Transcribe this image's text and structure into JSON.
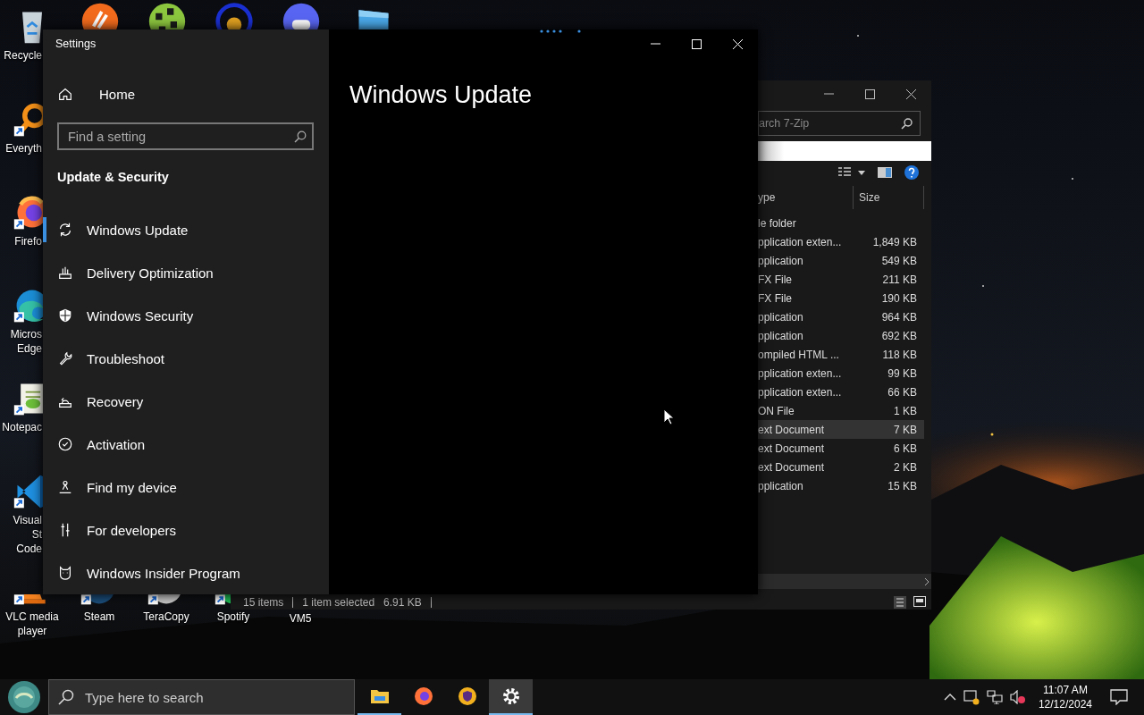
{
  "desktop": {
    "top_icons": [
      {
        "kind": "orange-app"
      },
      {
        "kind": "green-globe"
      },
      {
        "kind": "blue-ring"
      },
      {
        "kind": "chat-app"
      },
      {
        "kind": "monitor"
      }
    ],
    "left_icons": [
      {
        "kind": "recycle",
        "lines": [
          "Recycle"
        ]
      },
      {
        "kind": "magnifier",
        "lines": [
          "Everyth"
        ]
      },
      {
        "kind": "firefox",
        "lines": [
          "Firefo"
        ]
      },
      {
        "kind": "edge",
        "lines": [
          "Micros",
          "Edge"
        ]
      },
      {
        "kind": "notepad",
        "lines": [
          "Notepac"
        ]
      },
      {
        "kind": "vscode",
        "lines": [
          "Visual St",
          "Code"
        ]
      }
    ],
    "bottom_icons": [
      {
        "kind": "cone",
        "lines": [
          "VLC media",
          "player"
        ]
      },
      {
        "kind": "steam",
        "lines": [
          "Steam"
        ]
      },
      {
        "kind": "disc",
        "lines": [
          "TeraCopy"
        ]
      },
      {
        "kind": "music",
        "lines": [
          "Spotify"
        ]
      },
      {
        "kind": "none",
        "lines": [
          "VM5"
        ]
      }
    ]
  },
  "explorer": {
    "search": {
      "placeholder": "arch 7-Zip"
    },
    "columns": [
      "ype",
      "Size"
    ],
    "rows": [
      {
        "type": "le folder",
        "selected": false
      },
      {
        "type": "pplication exten...",
        "size": "1,849 KB",
        "selected": false
      },
      {
        "type": "pplication",
        "size": "549 KB",
        "selected": false
      },
      {
        "type": "FX File",
        "size": "211 KB",
        "selected": false
      },
      {
        "type": "FX File",
        "size": "190 KB",
        "selected": false
      },
      {
        "type": "pplication",
        "size": "964 KB",
        "selected": false
      },
      {
        "type": "pplication",
        "size": "692 KB",
        "selected": false
      },
      {
        "type": "ompiled HTML ...",
        "size": "118 KB",
        "selected": false
      },
      {
        "type": "pplication exten...",
        "size": "99 KB",
        "selected": false
      },
      {
        "type": "pplication exten...",
        "size": "66 KB",
        "selected": false
      },
      {
        "type": "ON File",
        "size": "1 KB",
        "selected": false
      },
      {
        "type": "ext Document",
        "size": "7 KB",
        "selected": true
      },
      {
        "type": "ext Document",
        "size": "6 KB",
        "selected": false
      },
      {
        "type": "ext Document",
        "size": "2 KB",
        "selected": false
      },
      {
        "type": "pplication",
        "size": "15 KB",
        "selected": false
      }
    ],
    "status_bar": {
      "item_count": "15 items",
      "selection": "1 item selected",
      "selection_size": "6.91 KB"
    }
  },
  "settings": {
    "title": "Settings",
    "home": "Home",
    "search": {
      "placeholder": "Find a setting"
    },
    "section": "Update & Security",
    "items": [
      {
        "label": "Windows Update",
        "selected": true
      },
      {
        "label": "Delivery Optimization",
        "selected": false
      },
      {
        "label": "Windows Security",
        "selected": false
      },
      {
        "label": "Troubleshoot",
        "selected": false
      },
      {
        "label": "Recovery",
        "selected": false
      },
      {
        "label": "Activation",
        "selected": false
      },
      {
        "label": "Find my device",
        "selected": false
      },
      {
        "label": "For developers",
        "selected": false
      },
      {
        "label": "Windows Insider Program",
        "selected": false
      }
    ],
    "page_title": "Windows Update"
  },
  "taskbar": {
    "search": {
      "placeholder": "Type here to search"
    },
    "apps": [
      {
        "kind": "folder",
        "running": true,
        "selected": false
      },
      {
        "kind": "firefox",
        "running": false,
        "selected": false
      },
      {
        "kind": "shield",
        "running": false,
        "selected": false
      },
      {
        "kind": "gear",
        "running": true,
        "selected": true
      }
    ],
    "time": "11:07 AM",
    "date": "12/12/2024"
  }
}
